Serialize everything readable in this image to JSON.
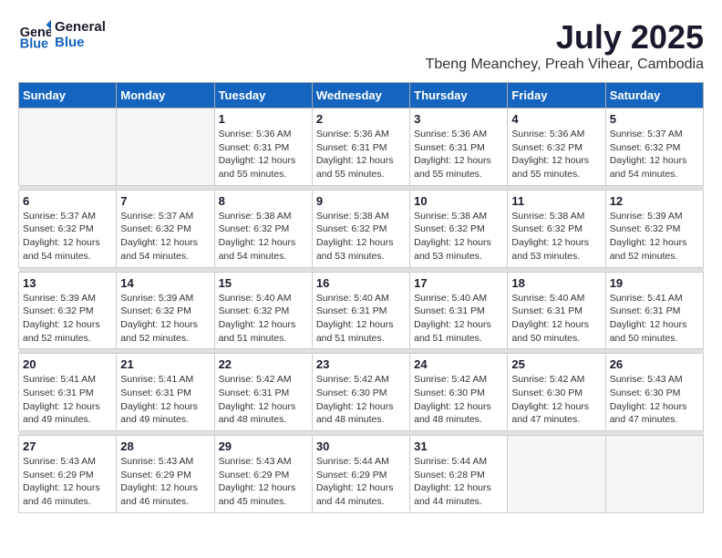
{
  "logo": {
    "line1": "General",
    "line2": "Blue"
  },
  "title": {
    "month_year": "July 2025",
    "location": "Tbeng Meanchey, Preah Vihear, Cambodia"
  },
  "weekdays": [
    "Sunday",
    "Monday",
    "Tuesday",
    "Wednesday",
    "Thursday",
    "Friday",
    "Saturday"
  ],
  "weeks": [
    [
      {
        "day": "",
        "info": ""
      },
      {
        "day": "",
        "info": ""
      },
      {
        "day": "1",
        "info": "Sunrise: 5:36 AM\nSunset: 6:31 PM\nDaylight: 12 hours and 55 minutes."
      },
      {
        "day": "2",
        "info": "Sunrise: 5:36 AM\nSunset: 6:31 PM\nDaylight: 12 hours and 55 minutes."
      },
      {
        "day": "3",
        "info": "Sunrise: 5:36 AM\nSunset: 6:31 PM\nDaylight: 12 hours and 55 minutes."
      },
      {
        "day": "4",
        "info": "Sunrise: 5:36 AM\nSunset: 6:32 PM\nDaylight: 12 hours and 55 minutes."
      },
      {
        "day": "5",
        "info": "Sunrise: 5:37 AM\nSunset: 6:32 PM\nDaylight: 12 hours and 54 minutes."
      }
    ],
    [
      {
        "day": "6",
        "info": "Sunrise: 5:37 AM\nSunset: 6:32 PM\nDaylight: 12 hours and 54 minutes."
      },
      {
        "day": "7",
        "info": "Sunrise: 5:37 AM\nSunset: 6:32 PM\nDaylight: 12 hours and 54 minutes."
      },
      {
        "day": "8",
        "info": "Sunrise: 5:38 AM\nSunset: 6:32 PM\nDaylight: 12 hours and 54 minutes."
      },
      {
        "day": "9",
        "info": "Sunrise: 5:38 AM\nSunset: 6:32 PM\nDaylight: 12 hours and 53 minutes."
      },
      {
        "day": "10",
        "info": "Sunrise: 5:38 AM\nSunset: 6:32 PM\nDaylight: 12 hours and 53 minutes."
      },
      {
        "day": "11",
        "info": "Sunrise: 5:38 AM\nSunset: 6:32 PM\nDaylight: 12 hours and 53 minutes."
      },
      {
        "day": "12",
        "info": "Sunrise: 5:39 AM\nSunset: 6:32 PM\nDaylight: 12 hours and 52 minutes."
      }
    ],
    [
      {
        "day": "13",
        "info": "Sunrise: 5:39 AM\nSunset: 6:32 PM\nDaylight: 12 hours and 52 minutes."
      },
      {
        "day": "14",
        "info": "Sunrise: 5:39 AM\nSunset: 6:32 PM\nDaylight: 12 hours and 52 minutes."
      },
      {
        "day": "15",
        "info": "Sunrise: 5:40 AM\nSunset: 6:32 PM\nDaylight: 12 hours and 51 minutes."
      },
      {
        "day": "16",
        "info": "Sunrise: 5:40 AM\nSunset: 6:31 PM\nDaylight: 12 hours and 51 minutes."
      },
      {
        "day": "17",
        "info": "Sunrise: 5:40 AM\nSunset: 6:31 PM\nDaylight: 12 hours and 51 minutes."
      },
      {
        "day": "18",
        "info": "Sunrise: 5:40 AM\nSunset: 6:31 PM\nDaylight: 12 hours and 50 minutes."
      },
      {
        "day": "19",
        "info": "Sunrise: 5:41 AM\nSunset: 6:31 PM\nDaylight: 12 hours and 50 minutes."
      }
    ],
    [
      {
        "day": "20",
        "info": "Sunrise: 5:41 AM\nSunset: 6:31 PM\nDaylight: 12 hours and 49 minutes."
      },
      {
        "day": "21",
        "info": "Sunrise: 5:41 AM\nSunset: 6:31 PM\nDaylight: 12 hours and 49 minutes."
      },
      {
        "day": "22",
        "info": "Sunrise: 5:42 AM\nSunset: 6:31 PM\nDaylight: 12 hours and 48 minutes."
      },
      {
        "day": "23",
        "info": "Sunrise: 5:42 AM\nSunset: 6:30 PM\nDaylight: 12 hours and 48 minutes."
      },
      {
        "day": "24",
        "info": "Sunrise: 5:42 AM\nSunset: 6:30 PM\nDaylight: 12 hours and 48 minutes."
      },
      {
        "day": "25",
        "info": "Sunrise: 5:42 AM\nSunset: 6:30 PM\nDaylight: 12 hours and 47 minutes."
      },
      {
        "day": "26",
        "info": "Sunrise: 5:43 AM\nSunset: 6:30 PM\nDaylight: 12 hours and 47 minutes."
      }
    ],
    [
      {
        "day": "27",
        "info": "Sunrise: 5:43 AM\nSunset: 6:29 PM\nDaylight: 12 hours and 46 minutes."
      },
      {
        "day": "28",
        "info": "Sunrise: 5:43 AM\nSunset: 6:29 PM\nDaylight: 12 hours and 46 minutes."
      },
      {
        "day": "29",
        "info": "Sunrise: 5:43 AM\nSunset: 6:29 PM\nDaylight: 12 hours and 45 minutes."
      },
      {
        "day": "30",
        "info": "Sunrise: 5:44 AM\nSunset: 6:29 PM\nDaylight: 12 hours and 44 minutes."
      },
      {
        "day": "31",
        "info": "Sunrise: 5:44 AM\nSunset: 6:28 PM\nDaylight: 12 hours and 44 minutes."
      },
      {
        "day": "",
        "info": ""
      },
      {
        "day": "",
        "info": ""
      }
    ]
  ]
}
